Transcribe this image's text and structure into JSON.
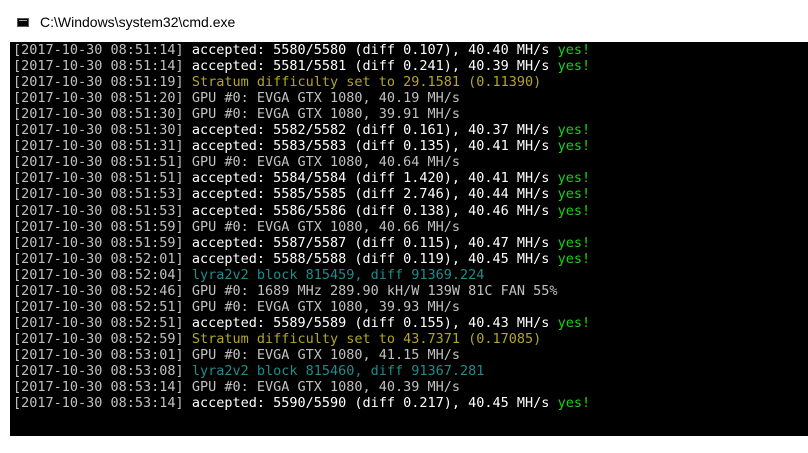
{
  "window": {
    "title": "C:\\Windows\\system32\\cmd.exe",
    "icon": "cmd-console-icon"
  },
  "colors": {
    "background": "#000000",
    "timestamp": "#c0c0c0",
    "accepted": "#ffffff",
    "yes": "#13d613",
    "stratum": "#b3a52a",
    "block": "#1e8c8c"
  },
  "lines": [
    {
      "ts": "[2017-10-30 08:51:14]",
      "kind": "acc",
      "text": " accepted: 5580/5580 (diff 0.107), 40.40 MH/s ",
      "yes": "yes!"
    },
    {
      "ts": "[2017-10-30 08:51:14]",
      "kind": "acc",
      "text": " accepted: 5581/5581 (diff 0.241), 40.39 MH/s ",
      "yes": "yes!"
    },
    {
      "ts": "[2017-10-30 08:51:19]",
      "kind": "yellow",
      "text": " Stratum difficulty set to 29.1581 (0.11390)",
      "yes": ""
    },
    {
      "ts": "[2017-10-30 08:51:20]",
      "kind": "gpu",
      "text": " GPU #0: EVGA GTX 1080, 40.19 MH/s",
      "yes": ""
    },
    {
      "ts": "[2017-10-30 08:51:30]",
      "kind": "gpu",
      "text": " GPU #0: EVGA GTX 1080, 39.91 MH/s",
      "yes": ""
    },
    {
      "ts": "[2017-10-30 08:51:30]",
      "kind": "acc",
      "text": " accepted: 5582/5582 (diff 0.161), 40.37 MH/s ",
      "yes": "yes!"
    },
    {
      "ts": "[2017-10-30 08:51:31]",
      "kind": "acc",
      "text": " accepted: 5583/5583 (diff 0.135), 40.41 MH/s ",
      "yes": "yes!"
    },
    {
      "ts": "[2017-10-30 08:51:51]",
      "kind": "gpu",
      "text": " GPU #0: EVGA GTX 1080, 40.64 MH/s",
      "yes": ""
    },
    {
      "ts": "[2017-10-30 08:51:51]",
      "kind": "acc",
      "text": " accepted: 5584/5584 (diff 1.420), 40.41 MH/s ",
      "yes": "yes!"
    },
    {
      "ts": "[2017-10-30 08:51:53]",
      "kind": "acc",
      "text": " accepted: 5585/5585 (diff 2.746), 40.44 MH/s ",
      "yes": "yes!"
    },
    {
      "ts": "[2017-10-30 08:51:53]",
      "kind": "acc",
      "text": " accepted: 5586/5586 (diff 0.138), 40.46 MH/s ",
      "yes": "yes!"
    },
    {
      "ts": "[2017-10-30 08:51:59]",
      "kind": "gpu",
      "text": " GPU #0: EVGA GTX 1080, 40.66 MH/s",
      "yes": ""
    },
    {
      "ts": "[2017-10-30 08:51:59]",
      "kind": "acc",
      "text": " accepted: 5587/5587 (diff 0.115), 40.47 MH/s ",
      "yes": "yes!"
    },
    {
      "ts": "[2017-10-30 08:52:01]",
      "kind": "acc",
      "text": " accepted: 5588/5588 (diff 0.119), 40.45 MH/s ",
      "yes": "yes!"
    },
    {
      "ts": "[2017-10-30 08:52:04]",
      "kind": "cyan",
      "text": " lyra2v2 block 815459, diff 91369.224",
      "yes": ""
    },
    {
      "ts": "[2017-10-30 08:52:46]",
      "kind": "gpu",
      "text": " GPU #0: 1689 MHz 289.90 kH/W 139W 81C FAN 55%",
      "yes": ""
    },
    {
      "ts": "[2017-10-30 08:52:51]",
      "kind": "gpu",
      "text": " GPU #0: EVGA GTX 1080, 39.93 MH/s",
      "yes": ""
    },
    {
      "ts": "[2017-10-30 08:52:51]",
      "kind": "acc",
      "text": " accepted: 5589/5589 (diff 0.155), 40.43 MH/s ",
      "yes": "yes!"
    },
    {
      "ts": "[2017-10-30 08:52:59]",
      "kind": "yellow",
      "text": " Stratum difficulty set to 43.7371 (0.17085)",
      "yes": ""
    },
    {
      "ts": "[2017-10-30 08:53:01]",
      "kind": "gpu",
      "text": " GPU #0: EVGA GTX 1080, 41.15 MH/s",
      "yes": ""
    },
    {
      "ts": "[2017-10-30 08:53:08]",
      "kind": "cyan",
      "text": " lyra2v2 block 815460, diff 91367.281",
      "yes": ""
    },
    {
      "ts": "[2017-10-30 08:53:14]",
      "kind": "gpu",
      "text": " GPU #0: EVGA GTX 1080, 40.39 MH/s",
      "yes": ""
    },
    {
      "ts": "[2017-10-30 08:53:14]",
      "kind": "acc",
      "text": " accepted: 5590/5590 (diff 0.217), 40.45 MH/s ",
      "yes": "yes!"
    }
  ]
}
